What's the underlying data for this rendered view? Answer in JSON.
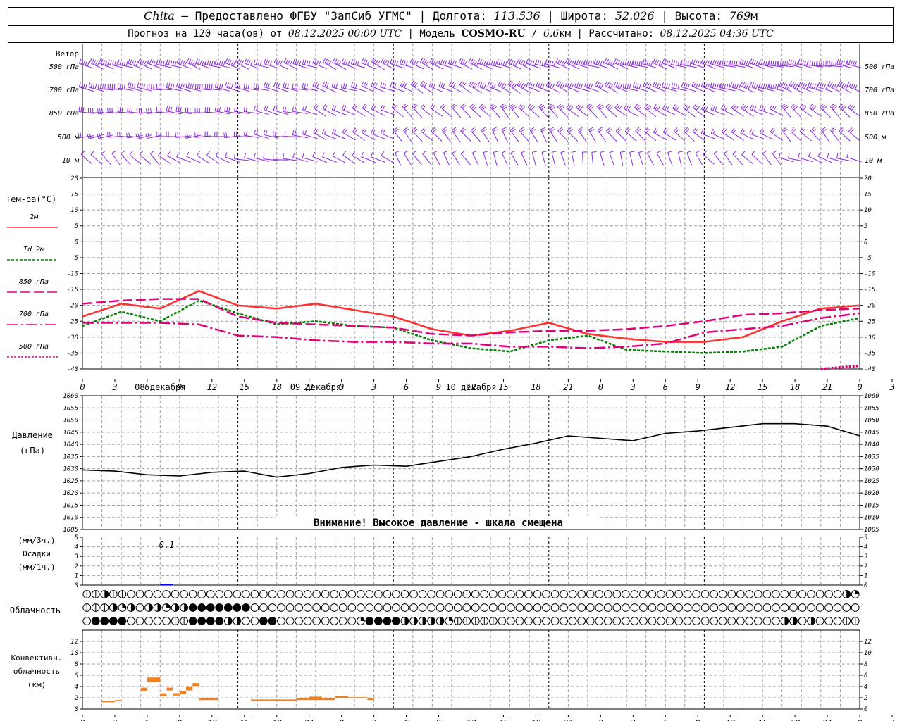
{
  "header": {
    "city": "Chita",
    "provider": "— Предоставлено ФГБУ \"ЗапСиб УГМС\"",
    "lon_label": "Долгота:",
    "lon": "113.536",
    "lat_label": "Широта:",
    "lat": "52.026",
    "alt_label": "Высота:",
    "alt": "769",
    "alt_unit": "м",
    "forecast_prefix": "Прогноз на 120 часа(ов) от",
    "forecast_time": "08.12.2025 00:00 UTC",
    "model_label": "Модель",
    "model": "COSMO-RU",
    "resolution": "6.6",
    "res_unit": "км",
    "computed_label": "Рассчитано:",
    "computed": "08.12.2025 04:36 UTC"
  },
  "chart_data": [
    {
      "type": "barbs",
      "panel": "wind",
      "title": "Ветер",
      "levels": [
        "500 гПа",
        "700 гПа",
        "850 гПа",
        "500 м",
        "10 м"
      ],
      "color": "#8a2be2",
      "direction_deg": {
        "500 гПа": [
          290,
          290,
          292,
          295,
          295,
          292,
          290,
          288,
          285,
          280
        ],
        "700 гПа": [
          280,
          282,
          285,
          290,
          300,
          300,
          295,
          290,
          290,
          295
        ],
        "850 гПа": [
          270,
          275,
          285,
          300,
          315,
          320,
          315,
          305,
          300,
          315
        ],
        "500 м": [
          260,
          265,
          280,
          300,
          320,
          330,
          325,
          310,
          300,
          320
        ],
        "10 м": [
          320,
          300,
          280,
          300,
          330,
          340,
          350,
          340,
          320,
          290
        ]
      },
      "speed_kt": {
        "500 гПа": [
          45,
          50,
          40,
          35,
          40,
          45,
          50,
          55,
          55,
          60
        ],
        "700 гПа": [
          35,
          40,
          30,
          30,
          30,
          35,
          35,
          40,
          45,
          45
        ],
        "850 гПа": [
          25,
          30,
          20,
          20,
          20,
          25,
          25,
          30,
          30,
          30
        ],
        "500 м": [
          20,
          20,
          15,
          15,
          15,
          20,
          20,
          20,
          20,
          20
        ],
        "10 м": [
          10,
          8,
          5,
          8,
          10,
          10,
          10,
          10,
          8,
          8
        ]
      }
    },
    {
      "type": "line",
      "panel": "temperature",
      "ylabel": "Тем-ра(°C)",
      "ylim": [
        -40,
        20
      ],
      "yticks": [
        20,
        15,
        10,
        5,
        0,
        -5,
        -10,
        -15,
        -20,
        -25,
        -30,
        -35,
        -40
      ],
      "x": [
        0,
        6,
        12,
        18,
        24,
        30,
        36,
        42,
        48,
        54,
        60,
        66,
        72,
        78,
        84,
        90,
        96,
        102,
        108,
        114,
        120
      ],
      "series": [
        {
          "name": "2м",
          "color": "#ff3030",
          "dash": "",
          "width": 2.5,
          "values": [
            -23.5,
            -19.5,
            -21,
            -15.5,
            -20,
            -21,
            -19.5,
            -21.5,
            -23.5,
            -27.5,
            -29.5,
            -28,
            -25.5,
            -29,
            -30.5,
            -31.5,
            -31.5,
            -30,
            -25,
            -21,
            -20
          ]
        },
        {
          "name": "Td 2м",
          "color": "#008000",
          "dash": "4 2",
          "width": 2.5,
          "values": [
            -26.5,
            -22,
            -25,
            -18.5,
            -22.5,
            -26,
            -25,
            -26.5,
            -27,
            -31,
            -33.5,
            -34.5,
            -31,
            -29.5,
            -34,
            -34.5,
            -35,
            -34.5,
            -33,
            -26.5,
            -24
          ]
        },
        {
          "name": "850 гПа",
          "color": "#e0007a",
          "dash": "14 5",
          "width": 2.5,
          "values": [
            -19.5,
            -18.5,
            -18,
            -18,
            -23.5,
            -25.5,
            -26,
            -26.5,
            -27,
            -29,
            -29.5,
            -28.5,
            -28,
            -28,
            -27.5,
            -26.5,
            -25,
            -23,
            -22.5,
            -21.5,
            -21
          ]
        },
        {
          "name": "700 гПа",
          "color": "#e0007a",
          "dash": "16 4 3 4",
          "width": 2.5,
          "values": [
            -25.5,
            -25.5,
            -25.5,
            -26,
            -29.5,
            -30,
            -31,
            -31.5,
            -31.5,
            -32,
            -32,
            -33,
            -33,
            -33.5,
            -33,
            -32,
            -28.5,
            -27.5,
            -26.5,
            -24,
            -22.5
          ]
        },
        {
          "name": "500 гПа",
          "color": "#e0007a",
          "dash": "3 2",
          "width": 3.5,
          "values": [
            null,
            null,
            null,
            null,
            null,
            null,
            null,
            null,
            null,
            null,
            null,
            null,
            null,
            null,
            null,
            null,
            null,
            null,
            null,
            -40,
            -39
          ]
        }
      ]
    },
    {
      "type": "line",
      "panel": "pressure",
      "ylabel": "Давление",
      "yunit": "(гПа)",
      "ylim": [
        1005,
        1060
      ],
      "yticks": [
        1060,
        1055,
        1050,
        1045,
        1040,
        1035,
        1030,
        1025,
        1020,
        1015,
        1010,
        1005
      ],
      "warning": "Внимание! Высокое давление - шкала смещена",
      "x": [
        0,
        6,
        12,
        18,
        24,
        30,
        36,
        42,
        48,
        54,
        60,
        66,
        72,
        78,
        84,
        90,
        96,
        102,
        108,
        114,
        120
      ],
      "series": [
        {
          "name": "pressure",
          "color": "#000000",
          "values": [
            1029.5,
            1029,
            1027.5,
            1027,
            1028.5,
            1029,
            1026.5,
            1028,
            1030.5,
            1031.5,
            1031,
            1033,
            1035,
            1038,
            1040.5,
            1043.5,
            1042.5,
            1041.5,
            1044.5,
            1045.5,
            1047,
            1048.5,
            1048.5,
            1047.5,
            1043.5
          ]
        }
      ]
    },
    {
      "type": "bar",
      "panel": "precipitation",
      "ylabel": "Осадки",
      "unit_top": "(мм/3ч.)",
      "unit_bottom": "(мм/1ч.)",
      "ylim": [
        0,
        5
      ],
      "yticks": [
        5,
        4,
        3,
        2,
        1,
        0
      ],
      "annotation": "0.1",
      "bars": [
        {
          "x0": 12,
          "x1": 14,
          "value": 0.1,
          "color": "#0000ff"
        }
      ]
    },
    {
      "type": "symbols",
      "panel": "cloudiness",
      "ylabel": "Облачность",
      "rows": [
        [
          1,
          1,
          3,
          1,
          1,
          0,
          0,
          0,
          0,
          0,
          0,
          0,
          0,
          0,
          0,
          0,
          0,
          0,
          0,
          0,
          0,
          0,
          0,
          0,
          0,
          0,
          0,
          0,
          0,
          0,
          0,
          0,
          0,
          0,
          0,
          0,
          0,
          0,
          0,
          0,
          0,
          0,
          0,
          0,
          0,
          0,
          0,
          0,
          0,
          0,
          0,
          0,
          0,
          0,
          0,
          0,
          0,
          0,
          0,
          0,
          0,
          0,
          0,
          0,
          0,
          0,
          0,
          0,
          0,
          0,
          0,
          0,
          0,
          0,
          0,
          0,
          0,
          0,
          0,
          0,
          0,
          0,
          0,
          0,
          0,
          0,
          3,
          2
        ],
        [
          1,
          1,
          1,
          3,
          2,
          3,
          1,
          3,
          3,
          2,
          3,
          3,
          4,
          4,
          4,
          4,
          4,
          4,
          4,
          0,
          0,
          0,
          0,
          0,
          0,
          0,
          0,
          0,
          0,
          0,
          0,
          0,
          0,
          0,
          0,
          0,
          0,
          0,
          0,
          0,
          0,
          0,
          0,
          0,
          0,
          0,
          0,
          0,
          0,
          0,
          0,
          0,
          0,
          0,
          0,
          0,
          0,
          0,
          0,
          0,
          0,
          0,
          0,
          0,
          0,
          0,
          0,
          0,
          0,
          0,
          0,
          0,
          0,
          0,
          0,
          0,
          0,
          0,
          0,
          0,
          0,
          0,
          0,
          0,
          0,
          0,
          0,
          0
        ],
        [
          0,
          4,
          4,
          4,
          4,
          0,
          0,
          0,
          0,
          0,
          1,
          1,
          4,
          4,
          4,
          4,
          3,
          3,
          0,
          0,
          4,
          4,
          0,
          0,
          0,
          0,
          0,
          0,
          0,
          0,
          0,
          2,
          4,
          4,
          4,
          4,
          3,
          3,
          3,
          3,
          3,
          2,
          1,
          1,
          1,
          1,
          1,
          0,
          0,
          0,
          0,
          0,
          0,
          0,
          0,
          0,
          0,
          0,
          0,
          0,
          0,
          0,
          0,
          0,
          0,
          0,
          0,
          0,
          0,
          0,
          0,
          0,
          0,
          0,
          0,
          0,
          0,
          0,
          0,
          3,
          3,
          0,
          3,
          1,
          0,
          0,
          1,
          1
        ]
      ]
    },
    {
      "type": "bar",
      "panel": "convective",
      "ylabel": "Конвективн.",
      "ylabel2": "облачность",
      "yunit": "(км)",
      "ylim": [
        0,
        14
      ],
      "yticks": [
        12,
        10,
        8,
        6,
        4,
        2,
        0
      ],
      "color": "#f08020",
      "segments": [
        {
          "x0": 3,
          "x1": 5,
          "y0": 1.2,
          "y1": 1.4
        },
        {
          "x0": 5,
          "x1": 6,
          "y0": 1.4,
          "y1": 1.6
        },
        {
          "x0": 9,
          "x1": 10,
          "y0": 3.2,
          "y1": 3.8
        },
        {
          "x0": 10,
          "x1": 12,
          "y0": 4.8,
          "y1": 5.6
        },
        {
          "x0": 12,
          "x1": 13,
          "y0": 2.3,
          "y1": 2.8
        },
        {
          "x0": 13,
          "x1": 14,
          "y0": 3.3,
          "y1": 3.8
        },
        {
          "x0": 14,
          "x1": 15,
          "y0": 2.4,
          "y1": 2.8
        },
        {
          "x0": 15,
          "x1": 16,
          "y0": 2.6,
          "y1": 3.2
        },
        {
          "x0": 16,
          "x1": 17,
          "y0": 3.3,
          "y1": 3.9
        },
        {
          "x0": 17,
          "x1": 18,
          "y0": 4.0,
          "y1": 4.6
        },
        {
          "x0": 18,
          "x1": 21,
          "y0": 1.6,
          "y1": 2.0
        },
        {
          "x0": 26,
          "x1": 33,
          "y0": 1.4,
          "y1": 1.7
        },
        {
          "x0": 33,
          "x1": 35,
          "y0": 1.6,
          "y1": 2.0
        },
        {
          "x0": 35,
          "x1": 37,
          "y0": 1.6,
          "y1": 2.2
        },
        {
          "x0": 37,
          "x1": 39,
          "y0": 1.6,
          "y1": 1.9
        },
        {
          "x0": 39,
          "x1": 41,
          "y0": 2.0,
          "y1": 2.3
        },
        {
          "x0": 41,
          "x1": 44,
          "y0": 1.9,
          "y1": 2.1
        },
        {
          "x0": 44,
          "x1": 45,
          "y0": 1.6,
          "y1": 1.9
        }
      ]
    }
  ],
  "axis": {
    "xticks": [
      0,
      3,
      6,
      9,
      12,
      15,
      18,
      21,
      0,
      3,
      6,
      9,
      12,
      15,
      18,
      21,
      0,
      3,
      6,
      9,
      12,
      15,
      18,
      21,
      0,
      3,
      6
    ],
    "days": [
      "08 декабря",
      "09 декабря",
      "10 декабря"
    ]
  },
  "colors": {
    "wind": "#8a2be2",
    "grid": "#a0a0a0",
    "zero_line": "#0000ff"
  }
}
